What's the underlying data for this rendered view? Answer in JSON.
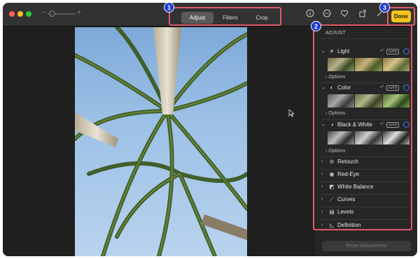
{
  "toolbar": {
    "zoom_minus": "−",
    "zoom_plus": "+",
    "tabs": [
      {
        "label": "Adjust",
        "active": true
      },
      {
        "label": "Filters",
        "active": false
      },
      {
        "label": "Crop",
        "active": false
      }
    ],
    "icons": [
      "info-icon",
      "more-icon",
      "heart-icon",
      "rotate-icon",
      "magic-wand-icon"
    ],
    "done_label": "Done"
  },
  "badges": [
    "1",
    "2",
    "3"
  ],
  "panel": {
    "title": "ADJUST",
    "expanded_sections": [
      {
        "label": "Light",
        "auto": "AUTO",
        "options": "Options"
      },
      {
        "label": "Color",
        "auto": "AUTO",
        "options": "Options"
      },
      {
        "label": "Black & White",
        "auto": "AUTO",
        "options": "Options"
      }
    ],
    "collapsed_sections": [
      {
        "label": "Retouch"
      },
      {
        "label": "Red-Eye"
      },
      {
        "label": "White Balance"
      },
      {
        "label": "Curves"
      },
      {
        "label": "Levels"
      },
      {
        "label": "Definition"
      }
    ],
    "reset_label": "Reset Adjustments"
  },
  "colors": {
    "accent_blue": "#2e7cf6",
    "done_yellow": "#f5c518",
    "annotation_red": "#e05a6a",
    "badge_blue": "#1f3fd6"
  }
}
